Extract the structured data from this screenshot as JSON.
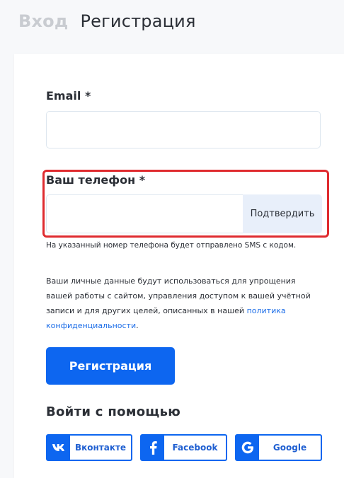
{
  "tabs": {
    "login": "Вход",
    "register": "Регистрация"
  },
  "form": {
    "email_label": "Email *",
    "phone_label": "Ваш телефон *",
    "confirm_button": "Подтвердить",
    "sms_note": "На указанный номер телефона будет отправлено SMS с кодом.",
    "privacy_text": "Ваши личные данные будут использоваться для упрощения вашей работы с сайтом, управления доступом к вашей учётной записи и для других целей, описанных в нашей ",
    "privacy_link": "политика конфиденциальности",
    "privacy_end": ".",
    "register_button": "Регистрация"
  },
  "social": {
    "heading": "Войти с помощью",
    "buttons": [
      {
        "label": "Вконтакте",
        "icon": "vk-icon"
      },
      {
        "label": "Facebook",
        "icon": "facebook-icon"
      },
      {
        "label": "Google",
        "icon": "google-icon"
      }
    ]
  },
  "colors": {
    "accent": "#0d66f0",
    "highlight": "#df2b2f"
  }
}
